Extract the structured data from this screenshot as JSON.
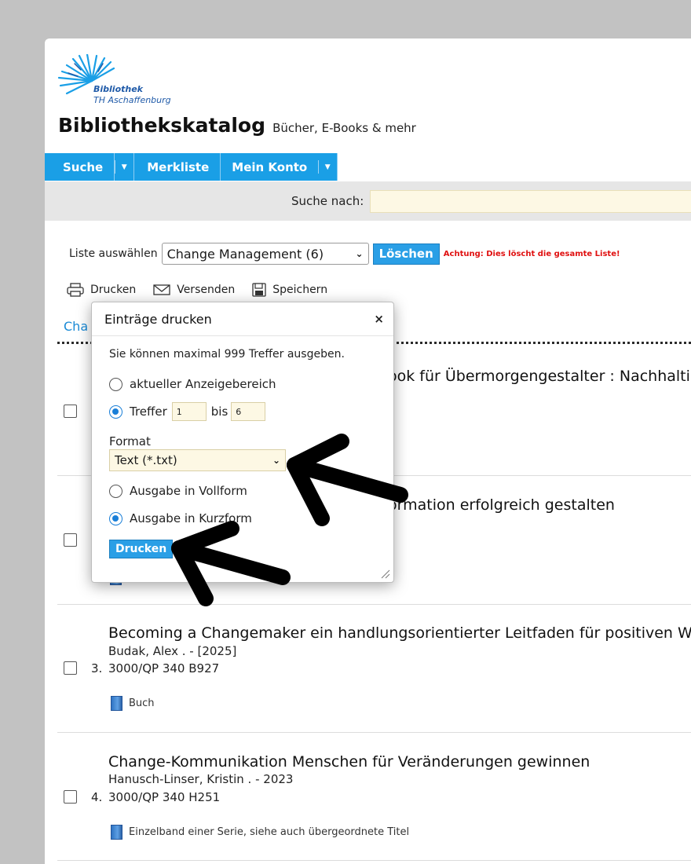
{
  "logo": {
    "line1": "Bibliothek",
    "line2": "TH Aschaffenburg"
  },
  "header": {
    "title": "Bibliothekskatalog",
    "subtitle": "Bücher, E-Books & mehr"
  },
  "nav": {
    "suche": "Suche",
    "merkliste": "Merkliste",
    "konto": "Mein Konto",
    "dropdown_icon": "caret-down-icon"
  },
  "search": {
    "label": "Suche nach:",
    "value": ""
  },
  "list": {
    "label": "Liste auswählen",
    "selected": "Change Management (6)",
    "delete_button": "Löschen",
    "warning": "Achtung: Dies löscht die gesamte Liste!",
    "heading_visible": "Cha"
  },
  "actions": {
    "print": "Drucken",
    "send": "Versenden",
    "save": "Speichern"
  },
  "items": [
    {
      "title_visible": "ook für Übermorgengestalter : Nachhalti"
    },
    {
      "title_visible": "ormation erfolgreich gestalten"
    },
    {
      "number": "3.",
      "title": "Becoming a Changemaker ein handlungsorientierter Leitfaden für positiven Wa",
      "author": "Budak, Alex . - [2025]",
      "signature": "3000/QP 340 B927",
      "media": "Buch"
    },
    {
      "number": "4.",
      "title": "Change-Kommunikation Menschen für Veränderungen gewinnen",
      "author": "Hanusch-Linser, Kristin . - 2023",
      "signature": "3000/QP 340 H251",
      "media": "Einzelband einer Serie, siehe auch übergeordnete Titel"
    }
  ],
  "modal": {
    "title": "Einträge drucken",
    "close": "×",
    "info": "Sie können maximal 999 Treffer ausgeben.",
    "opt_current": "aktueller Anzeigebereich",
    "opt_hits": "Treffer",
    "from": "1",
    "bis": "bis",
    "to": "6",
    "format_label": "Format",
    "format_value": "Text (*.txt)",
    "opt_full": "Ausgabe in Vollform",
    "opt_short": "Ausgabe in Kurzform",
    "button": "Drucken"
  },
  "colors": {
    "accent": "#1a9fe6",
    "warning": "#e01010",
    "input_bg": "#fdf8e4"
  }
}
